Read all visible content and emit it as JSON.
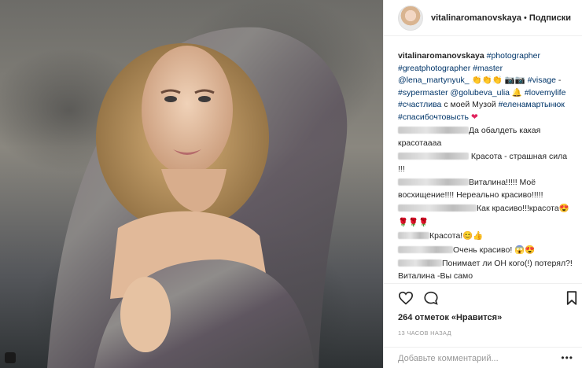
{
  "header": {
    "username": "vitalinaromanovskaya",
    "separator": "•",
    "follow_label": "Подписки"
  },
  "caption": {
    "username": "vitalinaromanovskaya",
    "t1": "#photographer",
    "t2": "#greatphotographer",
    "t3": "#master",
    "t4": "@lena_martynyuk_",
    "e1": "👏👏👏 📷📷",
    "t5": "#visage",
    "dash": "-",
    "t6": "#sypermaster",
    "t7": "@golubeva_ulia",
    "e2": "🔔",
    "t8": "#lovemylife",
    "t9": "#счастлива",
    "plain": "с моей Музой",
    "t10": "#еленамартынюк",
    "t11": "#спасибочтовысть",
    "heart": "❤"
  },
  "comments": [
    {
      "text": "Да обалдеть какая красотаааа"
    },
    {
      "text": "Красота - страшная сила !!!"
    },
    {
      "text": "Виталина!!!!! Моё восхищение!!!! Нереально красиво!!!!!"
    },
    {
      "text": "Как красиво!!!красота😍"
    },
    {
      "text": "🌹🌹🌹"
    },
    {
      "text": "Красота!😊👍"
    },
    {
      "text": "Очень красиво! 😱😍"
    },
    {
      "text": "Понимает ли ОН кого(!) потерял?! Виталина -Вы само"
    }
  ],
  "likes": "264 отметок «Нравится»",
  "time": "13 ЧАСОВ НАЗАД",
  "add_comment_placeholder": "Добавьте комментарий...",
  "icons": {
    "like": "heart-outline-icon",
    "comment": "speech-bubble-icon",
    "save": "bookmark-icon",
    "more": "ellipsis-icon"
  }
}
